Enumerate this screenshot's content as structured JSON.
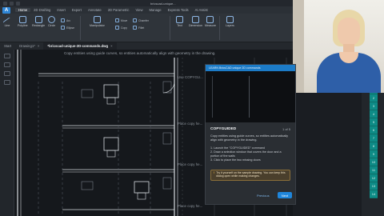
{
  "app": {
    "title": "bricscad-unique..."
  },
  "ribbon": {
    "tabs": [
      "Home",
      "2D Drafting",
      "Insert",
      "Export",
      "Annotate",
      "2D Parametric",
      "View",
      "Manage",
      "Express Tools",
      "AI Assist"
    ],
    "active_tab": "Home",
    "tools": {
      "line": "Line",
      "polyline": "Polyline",
      "rectangle": "Rectangle",
      "circle": "Circle",
      "arc": "Arc",
      "ellipse": "Ellipse",
      "manipulator": "Manipulator",
      "move": "Move",
      "copy": "Copy",
      "chamfer": "Chamfer",
      "fillet": "Fillet",
      "text": "Text",
      "dimension": "Dimension",
      "measure": "Measure",
      "layers": "Layers"
    }
  },
  "doc_tabs": [
    {
      "label": "Start",
      "active": false
    },
    {
      "label": "Drawing1*",
      "active": false
    },
    {
      "label": "*bricscad-unique-2D-commands.dwg",
      "active": true
    }
  ],
  "canvas": {
    "hint": "Copy entities using guide curves, so entities automatically align with geometry in the drawing.",
    "labels": {
      "use_copy": "Use COPYGU...",
      "place_copy_1": "Place copy he...",
      "place_copy_2": "Place copy he...",
      "place_copy_3": "Place copy he..."
    }
  },
  "tour": {
    "header": "LEARN BricsCAD unique 2D commands",
    "title": "COPYGUIDED",
    "count": "1 of 5",
    "description": "Copy entities using guide curves, so entities automatically align with geometry in the drawing.",
    "steps": [
      "1. Launch the \"COPYGUIDED\" command",
      "2. Draw a selection window that covers the door and a portion of the walls",
      "3. Click to place the two missing doors"
    ],
    "tip": "Try it yourself on the sample drawing. You can keep this dialog open while making changes.",
    "prev_label": "Previous",
    "next_label": "Next"
  },
  "right_strip": {
    "numbers": [
      "1",
      "2",
      "3",
      "4",
      "5",
      "6",
      "7",
      "8",
      "9",
      "10",
      "11",
      "12",
      "13",
      "14"
    ]
  },
  "colors": {
    "accent": "#1f86dc",
    "strip": "#0e8b86",
    "canvas": "#15181c"
  }
}
